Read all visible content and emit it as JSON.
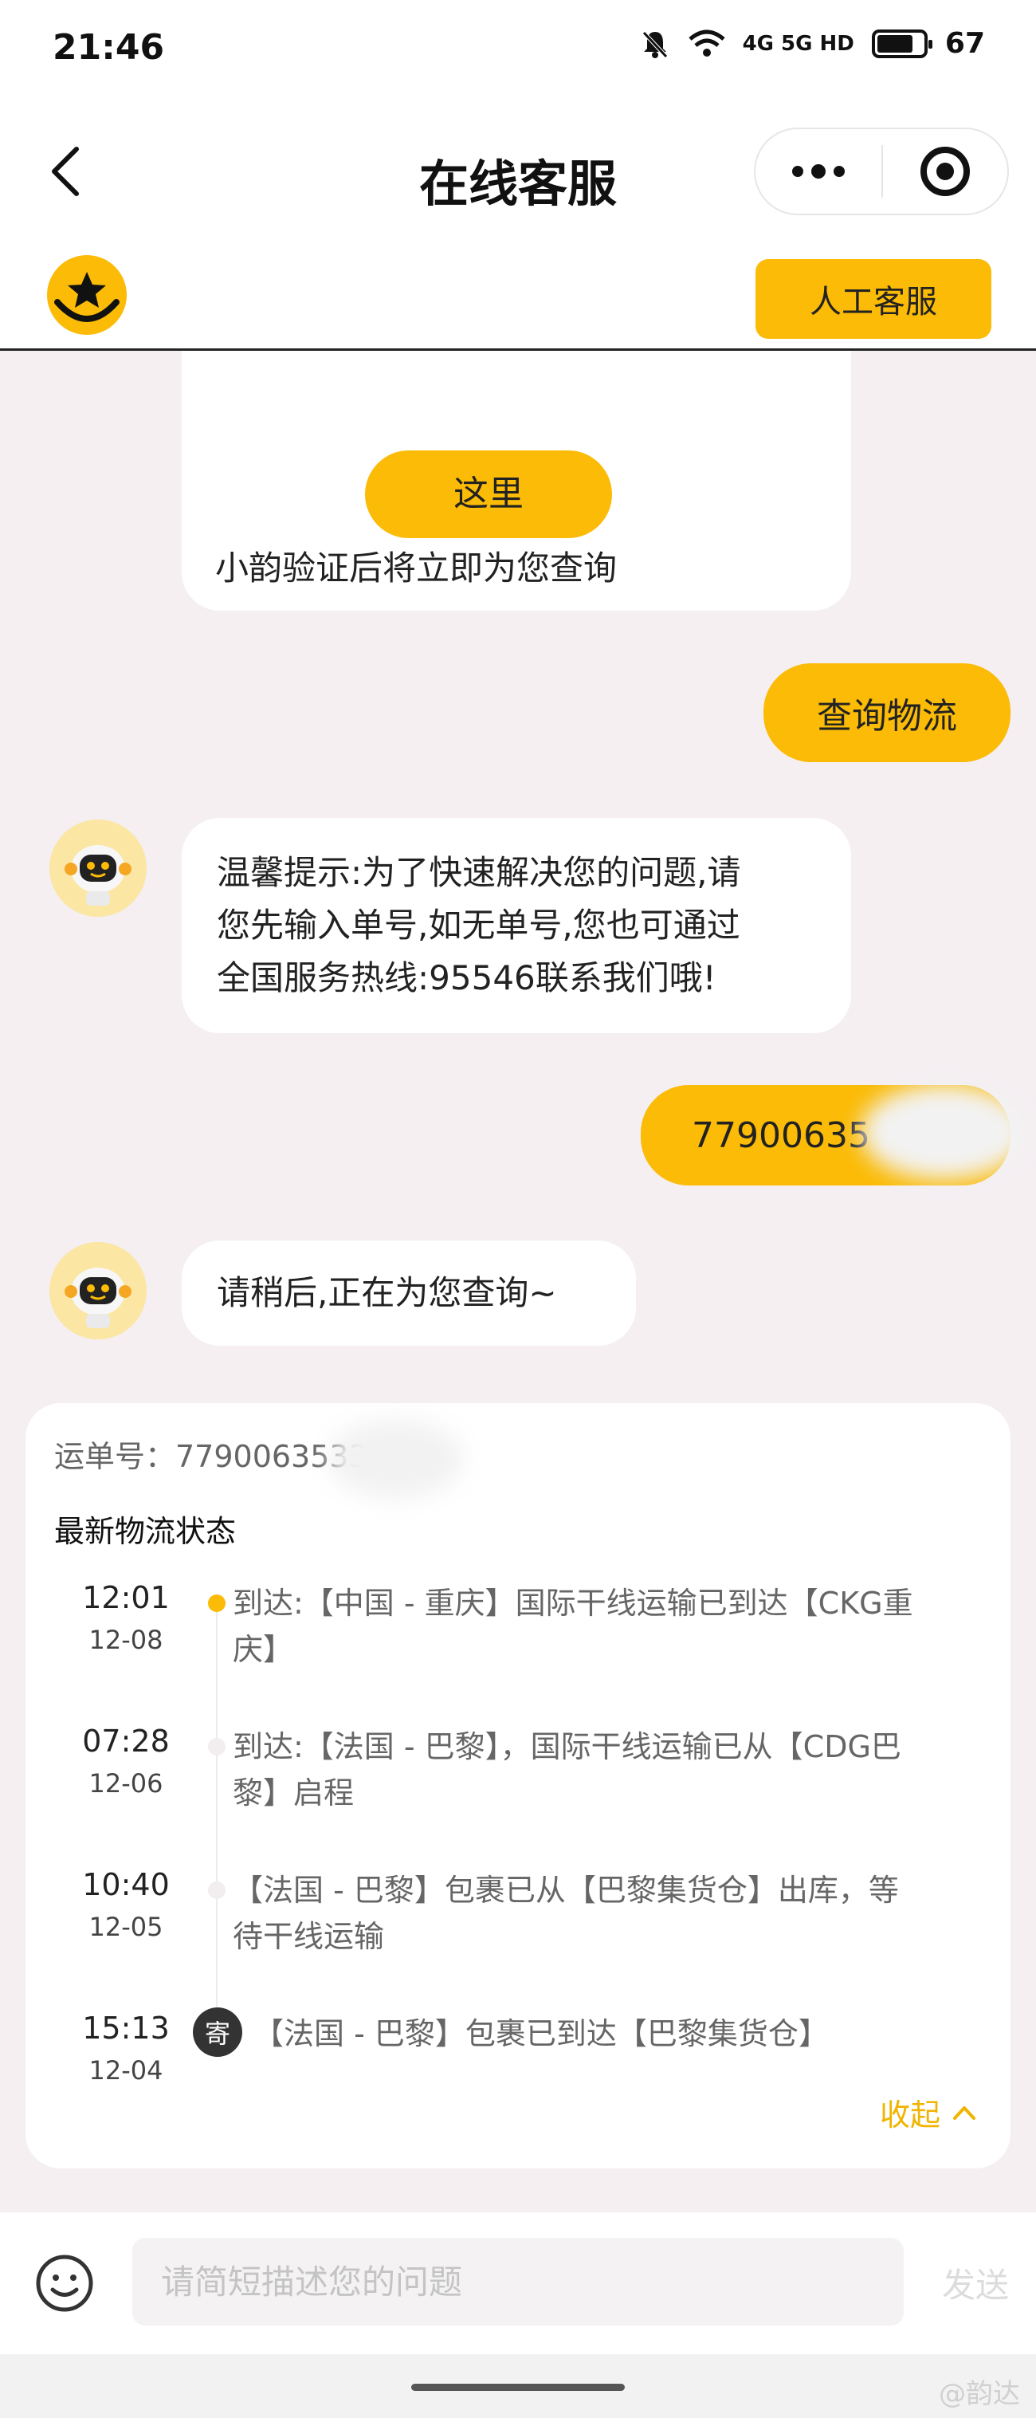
{
  "status_bar": {
    "time": "21:46",
    "network": "4G 5G HD",
    "battery": "67"
  },
  "nav": {
    "title": "在线客服"
  },
  "brand": {
    "agent_button": "人工客服"
  },
  "messages": {
    "bot_verify_button": "这里",
    "bot_verify_text": "小韵验证后将立即为您查询",
    "user_query": "查询物流",
    "bot_tip_lines": [
      "温馨提示:为了快速解决您的问题,请",
      "您先输入单号,如无单号,您也可通过",
      "全国服务热线:95546联系我们哦!"
    ],
    "user_tracking_number": "77900635",
    "bot_wait": "请稍后,正在为您查询~"
  },
  "tracking_card": {
    "waybill": "运单号：7790063533",
    "title": "最新物流状态",
    "events": [
      {
        "time": "12:01",
        "date": "12-08",
        "lines": [
          "到达:【中国 - 重庆】国际干线运输已到达【CKG重",
          "庆】"
        ],
        "active": true
      },
      {
        "time": "07:28",
        "date": "12-06",
        "lines": [
          "到达:【法国 - 巴黎】，国际干线运输已从【CDG巴",
          "黎】启程"
        ],
        "active": false
      },
      {
        "time": "10:40",
        "date": "12-05",
        "lines": [
          "【法国 - 巴黎】包裹已从【巴黎集货仓】出库，等",
          "待干线运输"
        ],
        "active": false
      },
      {
        "time": "15:13",
        "date": "12-04",
        "lines": [
          "【法国 - 巴黎】包裹已到达【巴黎集货仓】"
        ],
        "active": false,
        "badge": "寄"
      }
    ],
    "collapse_label": "收起"
  },
  "input_bar": {
    "placeholder": "请简短描述您的问题",
    "send_label": "发送"
  },
  "watermark": "@韵达"
}
